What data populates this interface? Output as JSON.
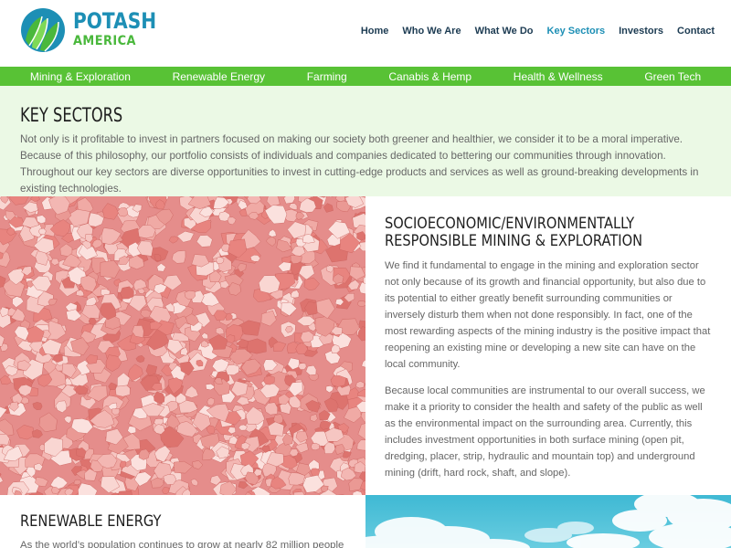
{
  "brand": {
    "line1": "POTASH",
    "line2": "AMERICA"
  },
  "nav": [
    {
      "label": "Home",
      "active": false
    },
    {
      "label": "Who We Are",
      "active": false
    },
    {
      "label": "What We Do",
      "active": false
    },
    {
      "label": "Key Sectors",
      "active": true
    },
    {
      "label": "Investors",
      "active": false
    },
    {
      "label": "Contact",
      "active": false
    }
  ],
  "sectors": [
    "Mining & Exploration",
    "Renewable Energy",
    "Farming",
    "Canabis & Hemp",
    "Health & Wellness",
    "Green Tech"
  ],
  "intro": {
    "title": "KEY SECTORS",
    "body": "Not only is it profitable to invest in partners focused on making our society both greener and healthier, we consider it to be a moral imperative. Because of this philosophy, our portfolio consists of individuals and companies dedicated to bettering our communities through innovation. Throughout our key sectors are diverse opportunities to invest in cutting-edge products and services as well as ground-breaking developments in existing technologies."
  },
  "mining": {
    "title_line1": "SOCIOECONOMIC/ENVIRONMENTALLY",
    "title_line2": "RESPONSIBLE MINING & EXPLORATION",
    "p1": "We find it fundamental to engage in the mining and exploration sector not only because of its growth and financial opportunity, but also due to its potential to either greatly benefit surrounding communities or inversely disturb them when not done responsibly. In fact, one of the most rewarding aspects of the mining industry is the positive impact that reopening an existing mine or developing a new site can have on the local community.",
    "p2": "Because local communities are instrumental to our overall success, we make it a priority to consider the health and safety of the public as well as the environmental impact on the surrounding area. Currently, this includes investment opportunities in both surface mining (open pit, dredging, placer, strip, hydraulic and mountain top) and underground mining (drift, hard rock, shaft, and slope)."
  },
  "energy": {
    "title": "RENEWABLE ENERGY",
    "body": "As the world’s population continues to grow at nearly 82 million people"
  },
  "colors": {
    "brand_blue": "#1d8fb5",
    "brand_green": "#4ab83c",
    "bar_green": "#58c235",
    "intro_bg": "#ebf9e5"
  }
}
